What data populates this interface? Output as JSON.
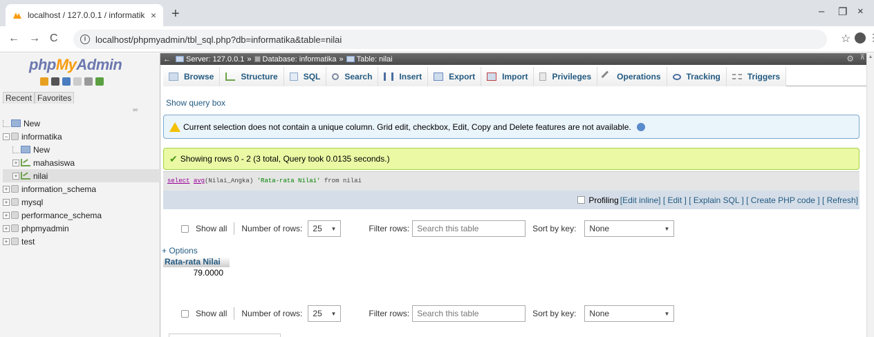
{
  "browser": {
    "tab_title": "localhost / 127.0.0.1 / informatik",
    "new_tab": "+",
    "tab_close": "×",
    "url": "localhost/phpmyadmin/tbl_sql.php?db=informatika&table=nilai",
    "minimize": "–",
    "maximize": "❐",
    "close": "×"
  },
  "nav": {
    "logo_php": "php",
    "logo_my": "My",
    "logo_admin": "Admin",
    "recent": "Recent",
    "favorites": "Favorites",
    "tree": [
      {
        "label": "New"
      },
      {
        "label": "informatika"
      },
      {
        "label": "New"
      },
      {
        "label": "mahasiswa"
      },
      {
        "label": "nilai"
      },
      {
        "label": "information_schema"
      },
      {
        "label": "mysql"
      },
      {
        "label": "performance_schema"
      },
      {
        "label": "phpmyadmin"
      },
      {
        "label": "test"
      }
    ]
  },
  "breadcrumb": {
    "server": "Server: 127.0.0.1",
    "database": "Database: informatika",
    "table": "Table: nilai"
  },
  "tabs": [
    "Browse",
    "Structure",
    "SQL",
    "Search",
    "Insert",
    "Export",
    "Import",
    "Privileges",
    "Operations",
    "Tracking",
    "Triggers"
  ],
  "main": {
    "show_query_box": "Show query box",
    "notice": "Current selection does not contain a unique column. Grid edit, checkbox, Edit, Copy and Delete features are not available.",
    "success": "Showing rows 0 - 2 (3 total, Query took 0.0135 seconds.)",
    "sql": {
      "kw_select": "select",
      "fn_avg": "avg",
      "args": "(Nilai_Angka)",
      "alias": "'Rata-rata Nilai'",
      "kw_from": "from",
      "table": "nilai"
    },
    "profiling": {
      "label": "Profiling",
      "edit_inline": "[Edit inline]",
      "edit": "[ Edit ]",
      "explain": "[ Explain SQL ]",
      "create_php": "[ Create PHP code ]",
      "refresh": "[ Refresh]"
    },
    "controls": {
      "show_all": "Show all",
      "number_of_rows": "Number of rows:",
      "rows_value": "25",
      "filter_rows": "Filter rows:",
      "filter_placeholder": "Search this table",
      "sort_by_key": "Sort by key:",
      "sort_value": "None"
    },
    "options": "+ Options",
    "result": {
      "column": "Rata-rata Nilai",
      "value": "79.0000"
    }
  }
}
